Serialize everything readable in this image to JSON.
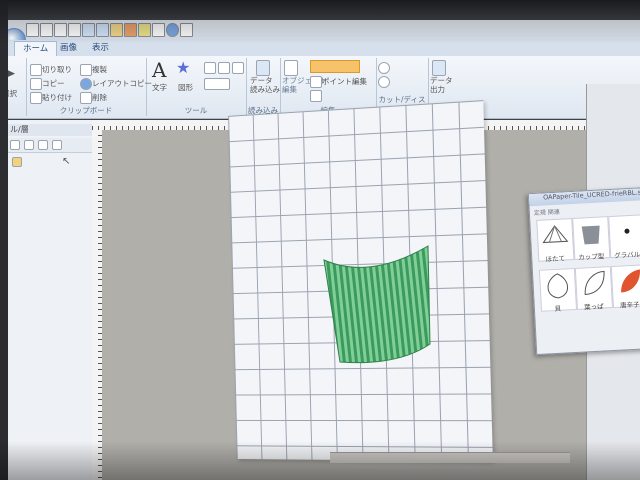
{
  "tabs": [
    {
      "label": "ホーム",
      "active": true
    },
    {
      "label": "画像",
      "active": false
    },
    {
      "label": "表示",
      "active": false
    }
  ],
  "ribbon": {
    "select_label": "選択",
    "clipboard": {
      "cut": "切り取り",
      "copy": "コピー",
      "paste": "貼り付け",
      "duplicate": "複製",
      "layout_copy": "レイアウトコピー",
      "delete": "削除",
      "group_label": "クリップボード"
    },
    "tools": {
      "text": "文字",
      "shape": "図形",
      "group_label": "ツール"
    },
    "data": {
      "data_button": "データ\n読み込み",
      "group_label": "読み込み"
    },
    "edit": {
      "object_edit": "オブジェクト\n編集",
      "point_edit": "ポイント編集",
      "group_label": "編集"
    },
    "cut": {
      "group_label": "カット/ディスプレイ"
    },
    "output": {
      "button": "データ\n出力"
    }
  },
  "left_panel": {
    "title": "ル/層"
  },
  "palette": {
    "title": "OAPaper-Tile_UCRED-frieRBL.s",
    "subtitle": "定規 関連",
    "items": [
      {
        "label": "ほたて"
      },
      {
        "label": "カップ型"
      },
      {
        "label": "グラバル"
      },
      {
        "label": "貝"
      },
      {
        "label": "葉っぱ"
      },
      {
        "label": "唐辛子"
      }
    ]
  },
  "colors": {
    "stripe_green": "#3c9a5e",
    "stripe_light": "#7fcf96",
    "ribbon_bg": "#e3eaf3",
    "highlight": "#f6c36a"
  }
}
